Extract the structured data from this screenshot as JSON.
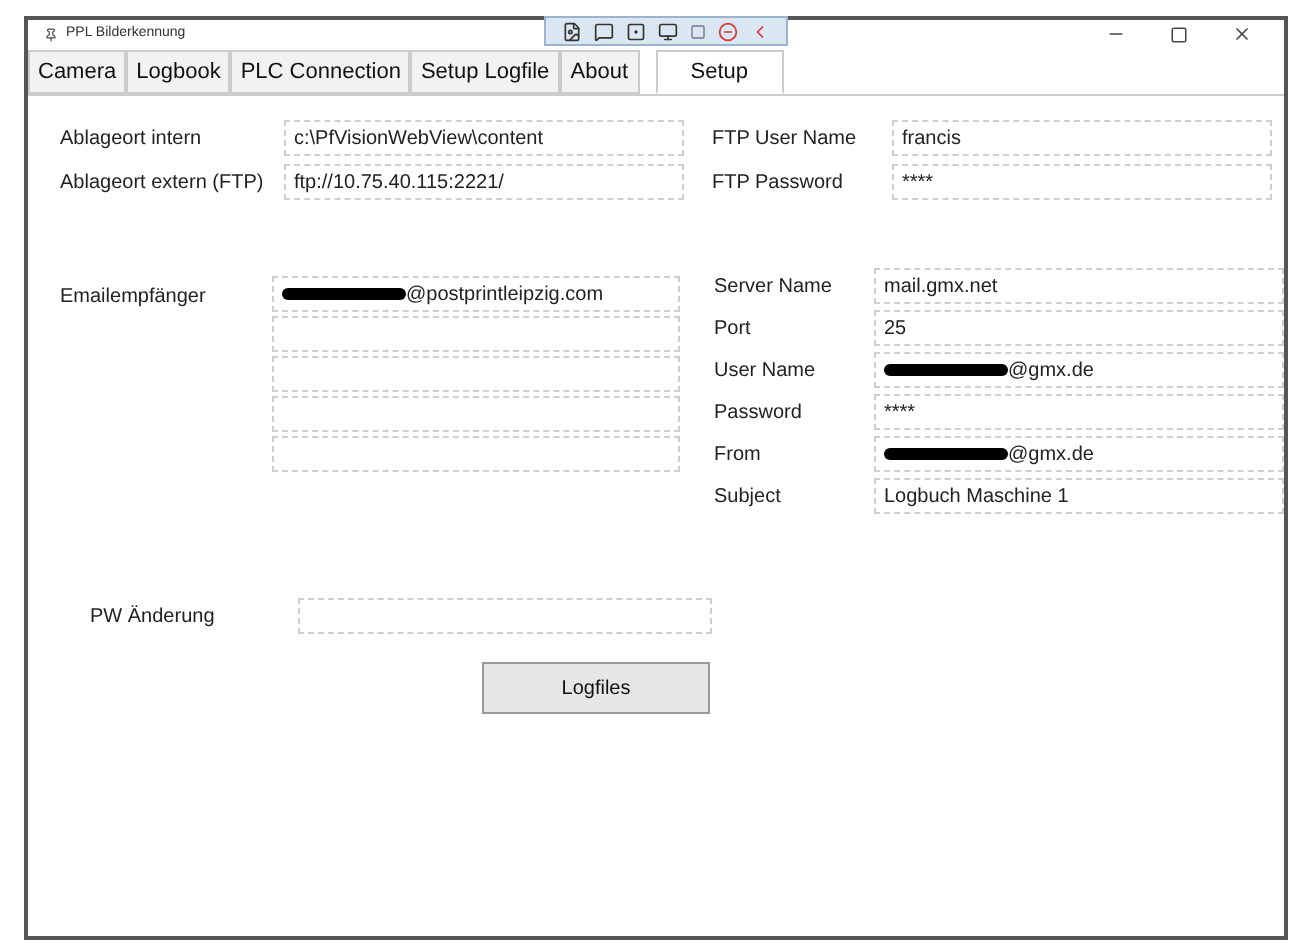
{
  "window": {
    "title": "PPL Bilderkennung"
  },
  "tabs": [
    {
      "label": "Camera",
      "selected": false
    },
    {
      "label": "Logbook",
      "selected": false
    },
    {
      "label": "PLC Connection",
      "selected": false
    },
    {
      "label": "Setup Logfile",
      "selected": false
    },
    {
      "label": "About",
      "selected": false
    },
    {
      "label": "Setup",
      "selected": true
    }
  ],
  "storage": [
    {
      "label": "Ablageort intern",
      "value": "c:\\PfVisionWebView\\content"
    },
    {
      "label": "Ablageort extern (FTP)",
      "value": "ftp://10.75.40.115:2221/"
    }
  ],
  "ftp": [
    {
      "label": "FTP User Name",
      "value": "francis"
    },
    {
      "label": "FTP Password",
      "value": "****"
    }
  ],
  "email_recipients": {
    "label": "Emailempfänger",
    "fields": [
      {
        "kind": "text",
        "value": "@postprintleipzig.com",
        "redacted": true
      },
      {
        "kind": "empty"
      },
      {
        "kind": "empty"
      },
      {
        "kind": "empty"
      },
      {
        "kind": "empty"
      }
    ]
  },
  "mail_server": [
    {
      "label": "Server Name",
      "value": "mail.gmx.net",
      "redacted": false
    },
    {
      "label": "Port",
      "value": "25",
      "redacted": false
    },
    {
      "label": "User Name",
      "value": "@gmx.de",
      "redacted": true
    },
    {
      "label": "Password",
      "value": "****",
      "redacted": false
    },
    {
      "label": "From",
      "value": "@gmx.de",
      "redacted": true
    },
    {
      "label": "Subject",
      "value": "Logbuch Maschine 1",
      "redacted": false
    }
  ],
  "password_change": {
    "label": "PW Änderung"
  },
  "logfiles_button": "Logfiles"
}
